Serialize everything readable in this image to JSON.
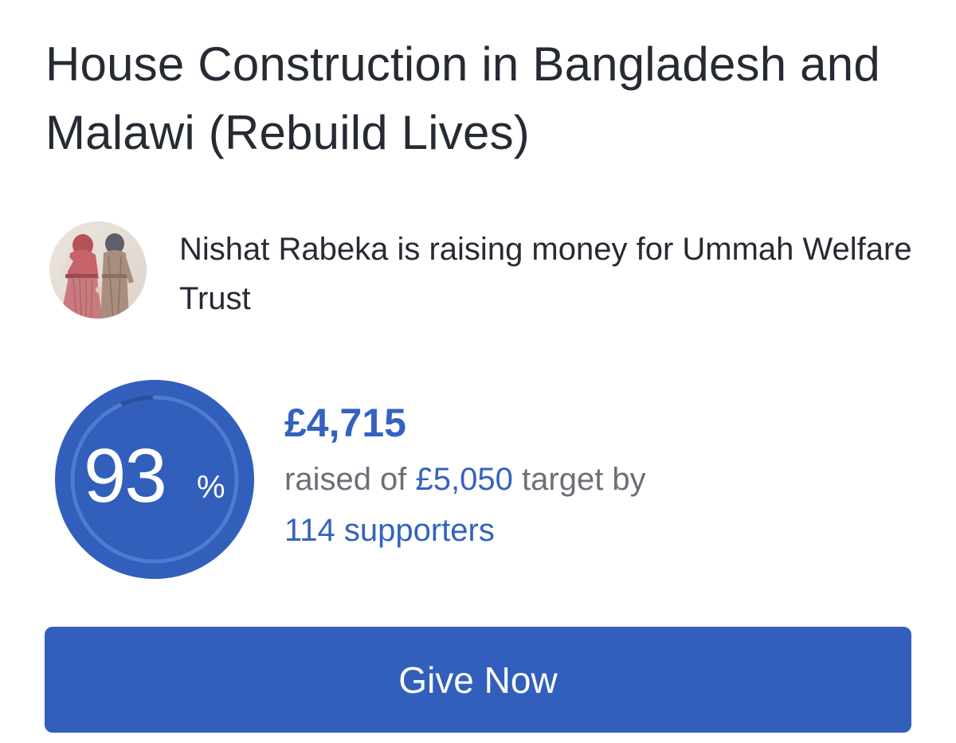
{
  "page": {
    "title": "House Construction in Bangladesh and Malawi (Rebuild Lives)"
  },
  "fundraiser": {
    "name": "Nishat Rabeka",
    "text": "Nishat Rabeka is raising money for Ummah Welfare Trust",
    "charity": "Ummah Welfare Trust"
  },
  "progress": {
    "percent_value": 93,
    "percent_label": "93",
    "percent_sign": "%",
    "amount_raised": "£4,715",
    "raised_prefix": "raised of",
    "target": "£5,050",
    "target_suffix": "target by",
    "supporters": "114 supporters"
  },
  "actions": {
    "give_label": "Give Now"
  },
  "colors": {
    "brand_blue": "#325fbb",
    "title_text": "#262a33",
    "muted_text": "#6b6f78"
  },
  "icons": {
    "avatar": "avatar-illustration-two-women"
  }
}
